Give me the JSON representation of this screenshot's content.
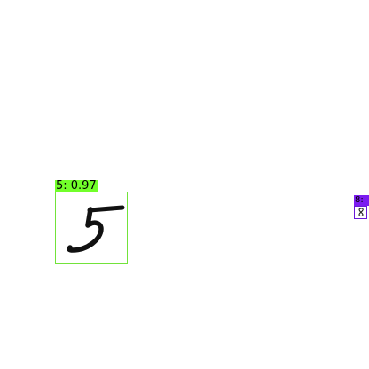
{
  "detections": [
    {
      "class": "5",
      "score": "0.97",
      "label": "5: 0.97",
      "color": "#72ff2a",
      "digit_icon": "handwritten-digit-5-icon"
    },
    {
      "class": "8",
      "label": "8:",
      "color": "#7c1cf0",
      "digit_icon": "handwritten-digit-8-icon"
    }
  ]
}
